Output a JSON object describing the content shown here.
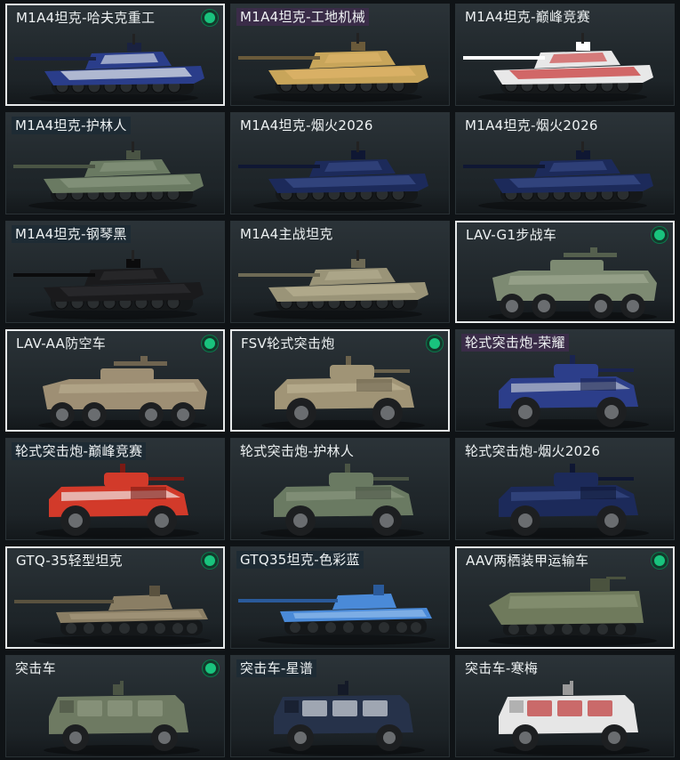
{
  "vehicles": [
    {
      "name": "M1A4坦克-哈夫克重工",
      "type": "tank",
      "selected": true,
      "equipped": true,
      "tag": "none",
      "colors": [
        "#2a3d8a",
        "#e8ecf0",
        "#1a2240"
      ]
    },
    {
      "name": "M1A4坦克-工地机械",
      "type": "tank",
      "selected": false,
      "equipped": false,
      "tag": "purple",
      "colors": [
        "#c8a55a",
        "#e0b56a",
        "#6a5a3a"
      ]
    },
    {
      "name": "M1A4坦克-巅峰竞赛",
      "type": "tank",
      "selected": false,
      "equipped": false,
      "tag": "none",
      "colors": [
        "#e8e8e8",
        "#c83030",
        "#ffffff"
      ]
    },
    {
      "name": "M1A4坦克-护林人",
      "type": "tank",
      "selected": false,
      "equipped": false,
      "tag": "dark",
      "colors": [
        "#6a7a62",
        "#8a9880",
        "#4a5444"
      ]
    },
    {
      "name": "M1A4坦克-烟火2026",
      "type": "tank",
      "selected": false,
      "equipped": false,
      "tag": "none",
      "colors": [
        "#1c2a5a",
        "#3a4f8a",
        "#0f1733"
      ]
    },
    {
      "name": "M1A4坦克-烟火2026",
      "type": "tank",
      "selected": false,
      "equipped": false,
      "tag": "none",
      "colors": [
        "#1c2a5a",
        "#3a4f8a",
        "#0f1733"
      ]
    },
    {
      "name": "M1A4坦克-钢琴黑",
      "type": "tank",
      "selected": false,
      "equipped": false,
      "tag": "dark",
      "colors": [
        "#1a1a1c",
        "#2e2e30",
        "#0b0b0c"
      ]
    },
    {
      "name": "M1A4主战坦克",
      "type": "tank",
      "selected": false,
      "equipped": false,
      "tag": "none",
      "colors": [
        "#9a9478",
        "#b8b092",
        "#6e6a55"
      ]
    },
    {
      "name": "LAV-G1步战车",
      "type": "ifv",
      "selected": true,
      "equipped": true,
      "tag": "none",
      "colors": [
        "#7d8a72",
        "#a3ae96",
        "#55604e"
      ]
    },
    {
      "name": "LAV-AA防空车",
      "type": "ifv",
      "selected": true,
      "equipped": true,
      "tag": "none",
      "colors": [
        "#9e8f74",
        "#bdb093",
        "#6f6450"
      ]
    },
    {
      "name": "FSV轮式突击炮",
      "type": "fsv",
      "selected": true,
      "equipped": true,
      "tag": "none",
      "colors": [
        "#a09476",
        "#bfb395",
        "#6b624c"
      ]
    },
    {
      "name": "轮式突击炮-荣耀",
      "type": "fsv",
      "selected": false,
      "equipped": false,
      "tag": "purple",
      "colors": [
        "#2c3e8a",
        "#c8ced6",
        "#1a2450"
      ]
    },
    {
      "name": "轮式突击炮-巅峰竞赛",
      "type": "fsv",
      "selected": false,
      "equipped": false,
      "tag": "dark",
      "colors": [
        "#d23a2a",
        "#f2f2f2",
        "#7a1a14"
      ]
    },
    {
      "name": "轮式突击炮-护林人",
      "type": "fsv",
      "selected": false,
      "equipped": false,
      "tag": "none",
      "colors": [
        "#6a7a62",
        "#8a9880",
        "#4a5444"
      ]
    },
    {
      "name": "轮式突击炮-烟火2026",
      "type": "fsv",
      "selected": false,
      "equipped": false,
      "tag": "none",
      "colors": [
        "#1c2a5a",
        "#3a4f8a",
        "#0f1733"
      ]
    },
    {
      "name": "GTQ-35轻型坦克",
      "type": "light",
      "selected": true,
      "equipped": true,
      "tag": "none",
      "colors": [
        "#8a7e64",
        "#aa9d80",
        "#5a523f"
      ]
    },
    {
      "name": "GTQ35坦克-色彩蓝",
      "type": "light",
      "selected": false,
      "equipped": false,
      "tag": "dark",
      "colors": [
        "#4a8ad8",
        "#9ec4ee",
        "#2a5a9a"
      ]
    },
    {
      "name": "AAV两栖装甲运输车",
      "type": "aav",
      "selected": true,
      "equipped": true,
      "tag": "none",
      "colors": [
        "#6f7a5c",
        "#8e9878",
        "#4a523e"
      ]
    },
    {
      "name": "突击车",
      "type": "mrap",
      "selected": false,
      "equipped": true,
      "tag": "none",
      "colors": [
        "#6e7a62",
        "#8d9880",
        "#4b5444"
      ]
    },
    {
      "name": "突击车-星谱",
      "type": "mrap",
      "selected": false,
      "equipped": false,
      "tag": "dark",
      "colors": [
        "#26324a",
        "#c8ced6",
        "#141a28"
      ]
    },
    {
      "name": "突击车-寒梅",
      "type": "mrap",
      "selected": false,
      "equipped": false,
      "tag": "none",
      "colors": [
        "#e6e6e6",
        "#c04040",
        "#9a9a9a"
      ]
    }
  ],
  "icons": {
    "equipped": "status-dot-icon"
  }
}
